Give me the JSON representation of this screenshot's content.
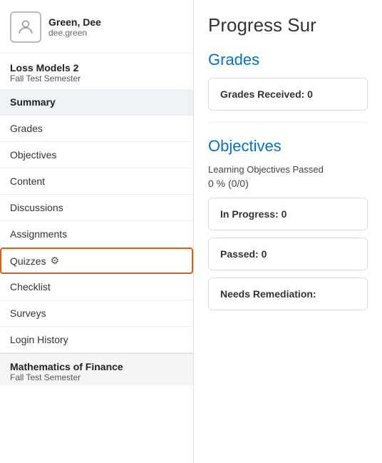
{
  "user": {
    "name": "Green, Dee",
    "login": "dee.green"
  },
  "sidebar": {
    "course1": {
      "title": "Loss Models 2",
      "semester": "Fall Test Semester"
    },
    "nav_items": [
      {
        "label": "Summary",
        "active": true
      },
      {
        "label": "Grades",
        "active": false
      },
      {
        "label": "Objectives",
        "active": false
      },
      {
        "label": "Content",
        "active": false
      },
      {
        "label": "Discussions",
        "active": false
      },
      {
        "label": "Assignments",
        "active": false
      },
      {
        "label": "Quizzes",
        "active": false,
        "special": true
      },
      {
        "label": "Checklist",
        "active": false
      },
      {
        "label": "Surveys",
        "active": false
      },
      {
        "label": "Login History",
        "active": false
      }
    ],
    "course2": {
      "title": "Mathematics of Finance",
      "semester": "Fall Test Semester"
    }
  },
  "main": {
    "page_title": "Progress Sur",
    "grades_section": {
      "title": "Grades",
      "received_label": "Grades Received: 0"
    },
    "objectives_section": {
      "title": "Objectives",
      "subtitle": "Learning Objectives Passed",
      "percent": "0 % (0/0)",
      "in_progress_label": "In Progress: 0",
      "passed_label": "Passed: 0",
      "needs_remediation_label": "Needs Remediation:"
    }
  }
}
